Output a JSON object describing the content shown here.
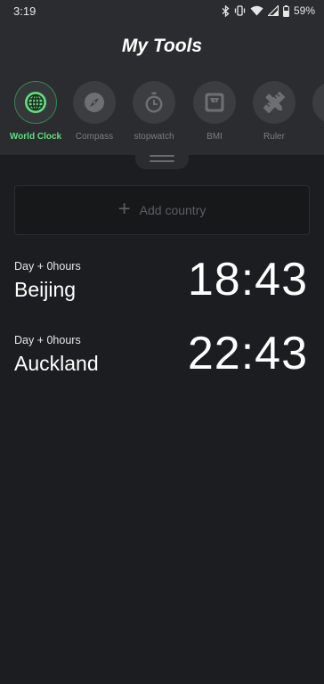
{
  "status_bar": {
    "time": "3:19",
    "battery": "59%",
    "icons": [
      "bluetooth-icon",
      "vibrate-icon",
      "wifi-icon",
      "signal-icon",
      "battery-icon"
    ]
  },
  "header": {
    "title": "My Tools"
  },
  "tools": [
    {
      "label": "World Clock",
      "icon": "globe-icon",
      "active": true
    },
    {
      "label": "Compass",
      "icon": "compass-icon",
      "active": false
    },
    {
      "label": "stopwatch",
      "icon": "stopwatch-icon",
      "active": false
    },
    {
      "label": "BMI",
      "icon": "scale-icon",
      "active": false
    },
    {
      "label": "Ruler",
      "icon": "ruler-icon",
      "active": false
    }
  ],
  "add_country": {
    "label": "Add country"
  },
  "clocks": [
    {
      "offset": "Day + 0hours",
      "city": "Beijing",
      "time": "18:43"
    },
    {
      "offset": "Day + 0hours",
      "city": "Auckland",
      "time": "22:43"
    }
  ],
  "colors": {
    "accent": "#5ee07e",
    "background": "#1c1d20",
    "header_bg": "#2b2c2f"
  }
}
